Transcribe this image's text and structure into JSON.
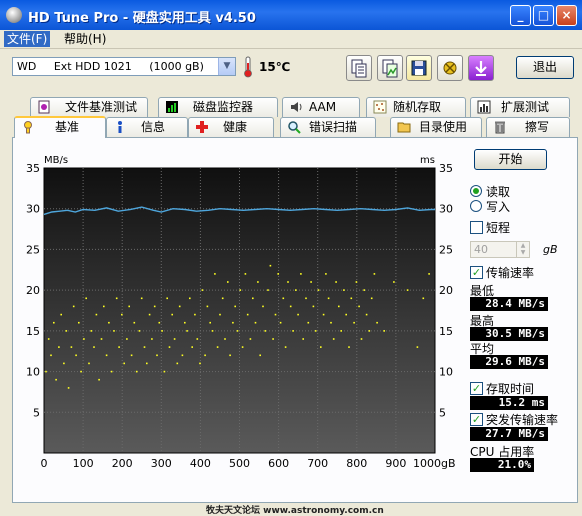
{
  "window": {
    "title": "HD Tune Pro - 硬盘实用工具 v4.50",
    "minimize": "_",
    "maximize": "□",
    "close": "×"
  },
  "menu": [
    "文件(F)",
    "帮助(H)"
  ],
  "toolbar": {
    "drive": "WD     Ext HDD 1021     (1000 gB)",
    "temperature": "15℃",
    "buttons": [
      "copy-text-icon",
      "copy-image-icon",
      "save-icon",
      "screenshot-icon",
      "download-icon"
    ],
    "exit": "退出"
  },
  "tabs_top": [
    {
      "label": "文件基准测试",
      "icon": "file-benchmark-icon"
    },
    {
      "label": "磁盘监控器",
      "icon": "disk-monitor-icon"
    },
    {
      "label": "AAM",
      "icon": "speaker-icon"
    },
    {
      "label": "随机存取",
      "icon": "random-access-icon"
    },
    {
      "label": "扩展测试",
      "icon": "extra-tests-icon"
    }
  ],
  "tabs_bottom": [
    {
      "label": "基准",
      "icon": "benchmark-icon",
      "active": true
    },
    {
      "label": "信息",
      "icon": "info-icon"
    },
    {
      "label": "健康",
      "icon": "health-icon"
    },
    {
      "label": "错误扫描",
      "icon": "error-scan-icon"
    },
    {
      "label": "目录使用",
      "icon": "folder-usage-icon"
    },
    {
      "label": "擦写",
      "icon": "erase-icon"
    }
  ],
  "controls": {
    "start": "开始",
    "read": "读取",
    "write": "写入",
    "short_stroke": "短程",
    "short_value": "40",
    "short_unit": "gB",
    "transfer_rate": "传输速率",
    "min_label": "最低",
    "min_value": "28.4 MB/s",
    "max_label": "最高",
    "max_value": "30.5 MB/s",
    "avg_label": "平均",
    "avg_value": "29.6 MB/s",
    "access_time": "存取时间",
    "access_value": "15.2 ms",
    "burst_rate": "突发传输速率",
    "burst_value": "27.7 MB/s",
    "cpu_label": "CPU 占用率",
    "cpu_value": "21.0%"
  },
  "chart_data": {
    "type": "line",
    "left_unit": "MB/s",
    "right_unit": "ms",
    "x_unit": "gB",
    "xlim": [
      0,
      1000
    ],
    "ylim": [
      0,
      35
    ],
    "right_ylim": [
      0,
      35
    ],
    "x_ticks": [
      0,
      100,
      200,
      300,
      400,
      500,
      600,
      700,
      800,
      900,
      1000
    ],
    "y_ticks": [
      5,
      10,
      15,
      20,
      25,
      30,
      35
    ],
    "series": [
      {
        "role": "transfer-rate",
        "color": "#4ea6dc",
        "x": [
          0,
          20,
          40,
          60,
          80,
          100,
          130,
          160,
          190,
          220,
          250,
          280,
          300,
          330,
          360,
          390,
          420,
          450,
          480,
          510,
          540,
          570,
          600,
          630,
          660,
          690,
          720,
          750,
          780,
          810,
          840,
          870,
          900,
          930,
          960,
          990,
          1000
        ],
        "y": [
          29.3,
          29.6,
          29.7,
          29.8,
          29.6,
          29.9,
          29.8,
          30.1,
          29.7,
          29.9,
          30.2,
          29.8,
          29.6,
          30.0,
          29.9,
          29.7,
          29.8,
          30.0,
          29.9,
          29.8,
          29.9,
          30.0,
          29.9,
          29.8,
          29.9,
          30.0,
          29.9,
          29.8,
          29.9,
          30.0,
          29.9,
          29.8,
          29.9,
          30.1,
          29.8,
          29.9,
          29.9
        ]
      },
      {
        "role": "access-time",
        "color": "#ffff22",
        "style": "scatter",
        "x": [
          5,
          12,
          18,
          25,
          31,
          38,
          44,
          51,
          57,
          63,
          70,
          76,
          82,
          89,
          95,
          102,
          108,
          115,
          121,
          128,
          134,
          141,
          147,
          153,
          160,
          166,
          173,
          179,
          186,
          192,
          199,
          205,
          212,
          218,
          224,
          231,
          237,
          244,
          250,
          257,
          263,
          270,
          276,
          283,
          289,
          295,
          302,
          308,
          315,
          321,
          328,
          334,
          341,
          347,
          354,
          360,
          366,
          373,
          379,
          386,
          392,
          399,
          405,
          412,
          418,
          425,
          431,
          437,
          444,
          450,
          457,
          463,
          470,
          476,
          483,
          489,
          495,
          502,
          508,
          515,
          521,
          528,
          534,
          541,
          547,
          553,
          560,
          566,
          573,
          579,
          586,
          592,
          599,
          605,
          612,
          618,
          624,
          631,
          637,
          644,
          650,
          657,
          663,
          670,
          676,
          683,
          689,
          695,
          702,
          708,
          715,
          721,
          728,
          734,
          741,
          747,
          754,
          760,
          767,
          773,
          780,
          786,
          793,
          799,
          806,
          812,
          819,
          825,
          832,
          838,
          845,
          852,
          870,
          895,
          930,
          955,
          970,
          985
        ],
        "y": [
          10,
          14,
          12,
          16,
          9,
          13,
          17,
          11,
          15,
          8,
          13,
          18,
          12,
          16,
          10,
          14,
          19,
          11,
          15,
          13,
          17,
          9,
          14,
          18,
          12,
          16,
          10,
          15,
          19,
          13,
          17,
          11,
          14,
          18,
          12,
          16,
          10,
          15,
          19,
          13,
          11,
          17,
          14,
          18,
          12,
          16,
          15,
          10,
          19,
          13,
          17,
          14,
          11,
          18,
          12,
          16,
          15,
          19,
          13,
          17,
          14,
          11,
          20,
          12,
          18,
          16,
          15,
          22,
          13,
          17,
          19,
          14,
          21,
          12,
          16,
          18,
          15,
          20,
          13,
          22,
          17,
          14,
          19,
          16,
          21,
          12,
          18,
          15,
          20,
          23,
          14,
          17,
          22,
          16,
          19,
          13,
          21,
          18,
          15,
          20,
          17,
          22,
          14,
          19,
          16,
          21,
          18,
          15,
          20,
          13,
          17,
          22,
          19,
          16,
          14,
          21,
          18,
          15,
          20,
          17,
          13,
          19,
          16,
          21,
          18,
          14,
          20,
          17,
          15,
          19,
          22,
          16,
          15,
          21,
          20,
          13,
          19,
          22
        ]
      }
    ]
  },
  "watermark": "牧夫天文论坛 www.astronomy.com.cn"
}
